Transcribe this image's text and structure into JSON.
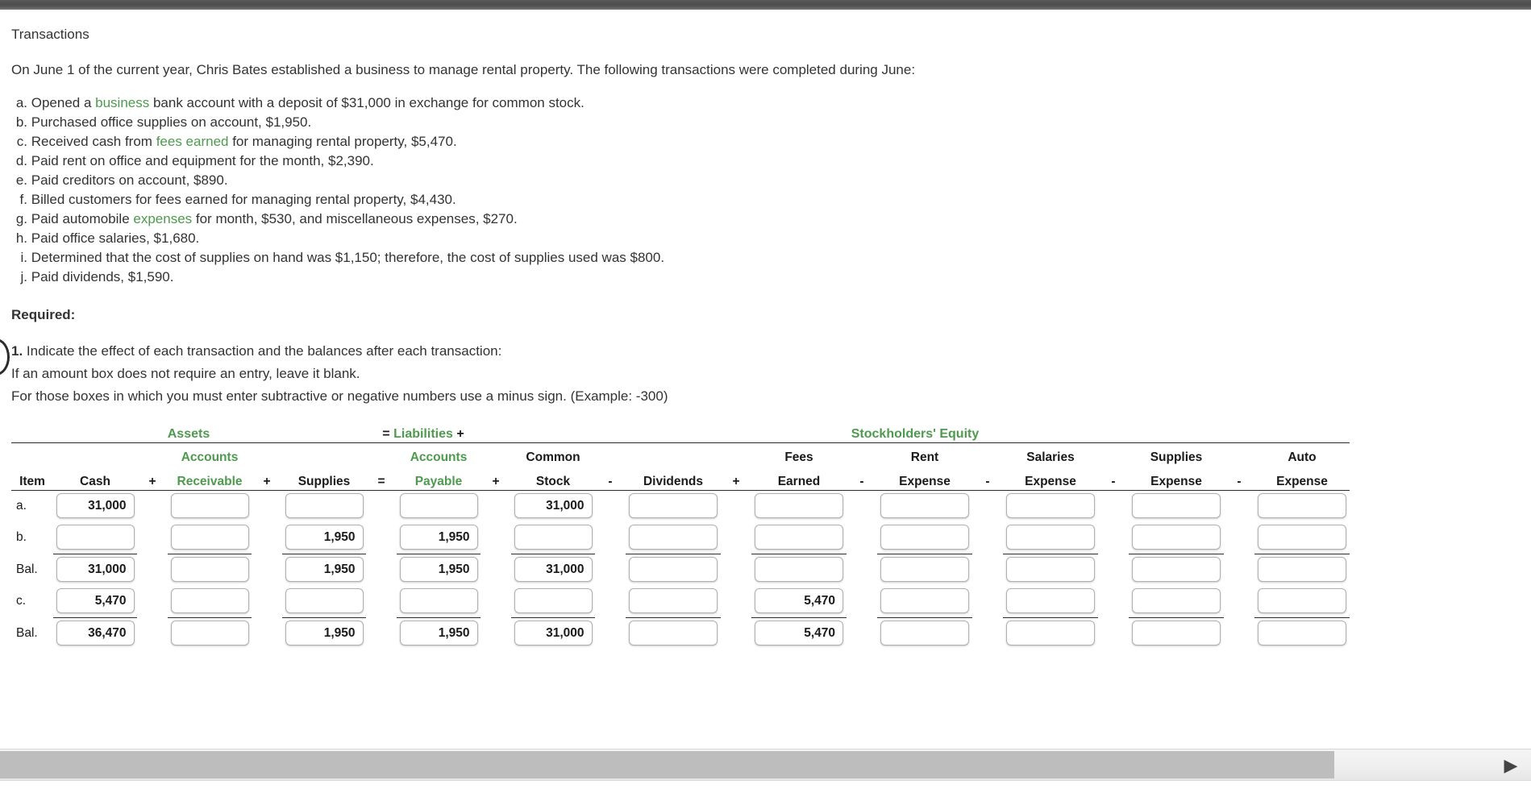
{
  "page": {
    "title": "Transactions",
    "intro": "On June 1 of the current year, Chris Bates established a business to manage rental property. The following transactions were completed during June:"
  },
  "transactions": [
    {
      "label": "a.",
      "pre": "Opened a ",
      "link": "business",
      "post": " bank account with a deposit of $31,000 in exchange for common stock."
    },
    {
      "label": "b.",
      "pre": "Purchased office supplies on account, $1,950.",
      "link": "",
      "post": ""
    },
    {
      "label": "c.",
      "pre": "Received cash from ",
      "link": "fees earned",
      "post": " for managing rental property, $5,470."
    },
    {
      "label": "d.",
      "pre": "Paid rent on office and equipment for the month, $2,390.",
      "link": "",
      "post": ""
    },
    {
      "label": "e.",
      "pre": "Paid creditors on account, $890.",
      "link": "",
      "post": ""
    },
    {
      "label": "f.",
      "pre": "Billed customers for fees earned for managing rental property, $4,430.",
      "link": "",
      "post": ""
    },
    {
      "label": "g.",
      "pre": "Paid automobile ",
      "link": "expenses",
      "post": " for month, $530, and miscellaneous expenses, $270."
    },
    {
      "label": "h.",
      "pre": "Paid office salaries, $1,680.",
      "link": "",
      "post": ""
    },
    {
      "label": "i.",
      "pre": "Determined that the cost of supplies on hand was $1,150; therefore, the cost of supplies used was $800.",
      "link": "",
      "post": ""
    },
    {
      "label": "j.",
      "pre": "Paid dividends, $1,590.",
      "link": "",
      "post": ""
    }
  ],
  "required": {
    "heading": "Required:",
    "item_number": "1.",
    "item_text": "Indicate the effect of each transaction and the balances after each transaction:",
    "note_blank": "If an amount box does not require an entry, leave it blank.",
    "note_negative": "For those boxes in which you must enter subtractive or negative numbers use a minus sign. (Example: -300)"
  },
  "table": {
    "groups": [
      {
        "label": "Assets",
        "green": true,
        "prefix": "",
        "suffix": ""
      },
      {
        "label": "Liabilities",
        "green": true,
        "prefix": "= ",
        "suffix": " +"
      },
      {
        "label": "Stockholders' Equity",
        "green": true,
        "prefix": "",
        "suffix": ""
      }
    ],
    "group_assets": "Assets",
    "group_liabilities": "Liabilities",
    "group_liabilities_prefix": "=",
    "group_liabilities_suffix": "+",
    "group_equity": "Stockholders' Equity",
    "header_item": "Item",
    "columns": [
      {
        "top": "",
        "bottom": "Cash",
        "green": false,
        "op_before": ""
      },
      {
        "top": "Accounts",
        "bottom": "Receivable",
        "green": true,
        "op_before": "+"
      },
      {
        "top": "",
        "bottom": "Supplies",
        "green": false,
        "op_before": "+"
      },
      {
        "top": "Accounts",
        "bottom": "Payable",
        "green": true,
        "op_before": "="
      },
      {
        "top": "Common",
        "bottom": "Stock",
        "green": false,
        "op_before": "+"
      },
      {
        "top": "",
        "bottom": "Dividends",
        "green": false,
        "op_before": "-"
      },
      {
        "top": "Fees",
        "bottom": "Earned",
        "green": false,
        "op_before": "+"
      },
      {
        "top": "Rent",
        "bottom": "Expense",
        "green": false,
        "op_before": "-"
      },
      {
        "top": "Salaries",
        "bottom": "Expense",
        "green": false,
        "op_before": "-"
      },
      {
        "top": "Supplies",
        "bottom": "Expense",
        "green": false,
        "op_before": "-"
      },
      {
        "top": "Auto",
        "bottom": "Expense",
        "green": false,
        "op_before": "-"
      }
    ],
    "rows": [
      {
        "label": "a.",
        "rule_after": false,
        "values": [
          "31,000",
          "",
          "",
          "",
          "31,000",
          "",
          "",
          "",
          "",
          "",
          ""
        ]
      },
      {
        "label": "b.",
        "rule_after": true,
        "values": [
          "",
          "",
          "1,950",
          "1,950",
          "",
          "",
          "",
          "",
          "",
          "",
          ""
        ]
      },
      {
        "label": "Bal.",
        "rule_after": false,
        "values": [
          "31,000",
          "",
          "1,950",
          "1,950",
          "31,000",
          "",
          "",
          "",
          "",
          "",
          ""
        ]
      },
      {
        "label": "c.",
        "rule_after": true,
        "values": [
          "5,470",
          "",
          "",
          "",
          "",
          "",
          "5,470",
          "",
          "",
          "",
          ""
        ]
      },
      {
        "label": "Bal.",
        "rule_after": false,
        "values": [
          "36,470",
          "",
          "1,950",
          "1,950",
          "31,000",
          "",
          "5,470",
          "",
          "",
          "",
          ""
        ]
      }
    ]
  },
  "scrollbar": {
    "right_arrow_glyph": "▶"
  },
  "colors": {
    "accent_green": "#4e9a4e",
    "text": "#333333",
    "rule": "#2b2b2b",
    "scroll_thumb": "#bdbdbd"
  }
}
